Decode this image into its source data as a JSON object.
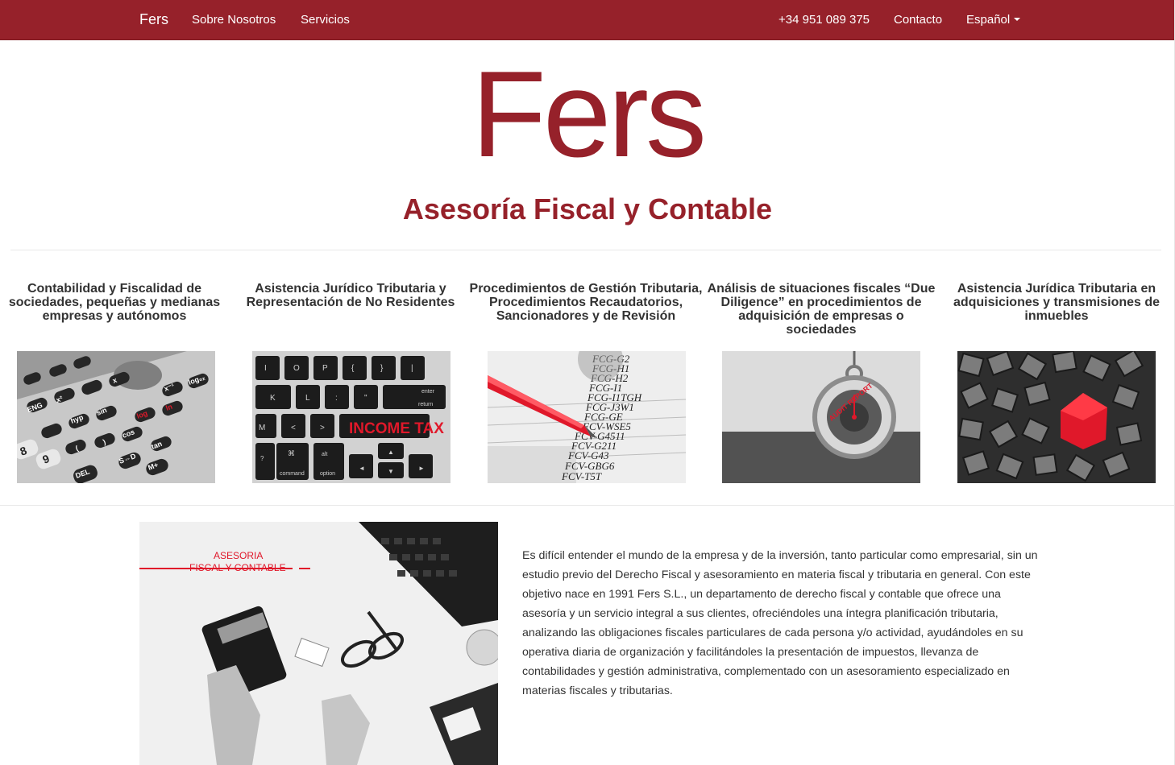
{
  "nav": {
    "brand": "Fers",
    "links": [
      "Sobre Nosotros",
      "Servicios"
    ],
    "phone": "+34 951 089 375",
    "contact": "Contacto",
    "language": "Español"
  },
  "hero": {
    "logo": "Fers",
    "subtitle": "Asesoría Fiscal y Contable"
  },
  "services": [
    {
      "title": "Contabilidad y Fiscalidad de sociedades, pequeñas y medianas empresas y autónomos"
    },
    {
      "title": "Asistencia Jurídico Tributaria y Representación de No Residentes"
    },
    {
      "title": "Procedimientos de Gestión Tributaria, Procedimientos Recaudatorios, Sancionadores y de Revisión"
    },
    {
      "title": "Análisis de situaciones fiscales “Due Diligence” en procedimientos de adquisición de empresas o sociedades"
    },
    {
      "title": "Asistencia Jurídica Tributaria en adquisiciones y transmisiones de inmuebles"
    }
  ],
  "images": {
    "keyboard_label": "INCOME TAX",
    "keys_row1": [
      "I",
      "O",
      "P",
      "{",
      "}",
      "|"
    ],
    "keys_row2": [
      "K",
      "L",
      ":",
      "\"",
      "enter"
    ],
    "keys_row3": [
      "M",
      "<",
      ">",
      "?"
    ],
    "keys_row4": [
      "⌘",
      "alt"
    ],
    "key_return": "return",
    "key_command": "command",
    "key_option": "option",
    "codes": [
      "FCG-G2",
      "FCG-H1",
      "FCG-H2",
      "FCG-I1",
      "FCG-I1TGH",
      "FCG-J3W1",
      "FCG-GE",
      "FCV-WSE5",
      "FCV-G4511",
      "FCV-G211",
      "FCV-G43",
      "FCV-GBG6",
      "FCV-T5T"
    ],
    "watch_label": "AUDIT REPORT",
    "calc_keys": [
      "ENG",
      "hyp",
      "sin",
      "cos",
      "tan",
      "log",
      "ln",
      "x⁻¹",
      "log₀ₓ",
      "S⇔D",
      "M+",
      "DEL",
      "8",
      "9",
      "(",
      ")",
      "x²",
      "x"
    ],
    "about_caption": [
      "ASESORIA",
      "FISCAL Y CONTABLE"
    ]
  },
  "about": {
    "paragraph": "Es difícil entender el mundo de la empresa y de la inversión, tanto particular como empresarial, sin un estudio previo del Derecho Fiscal y asesoramiento en materia fiscal y tributaria en general. Con este objetivo nace en 1991 Fers S.L., un departamento de derecho fiscal y contable que ofrece una asesoría y un servicio integral a sus clientes, ofreciéndoles una íntegra planificación tributaria, analizando las obligaciones fiscales particulares de cada persona y/o actividad, ayudándoles en su operativa diaria de organización y facilitándoles la presentación de impuestos, llevanza de contabilidades y gestión administrativa, complementado con un asesoramiento especializado en materias fiscales y tributarias."
  },
  "colors": {
    "brand": "#96212a",
    "text": "#333333",
    "accent_red": "#e0182a"
  }
}
